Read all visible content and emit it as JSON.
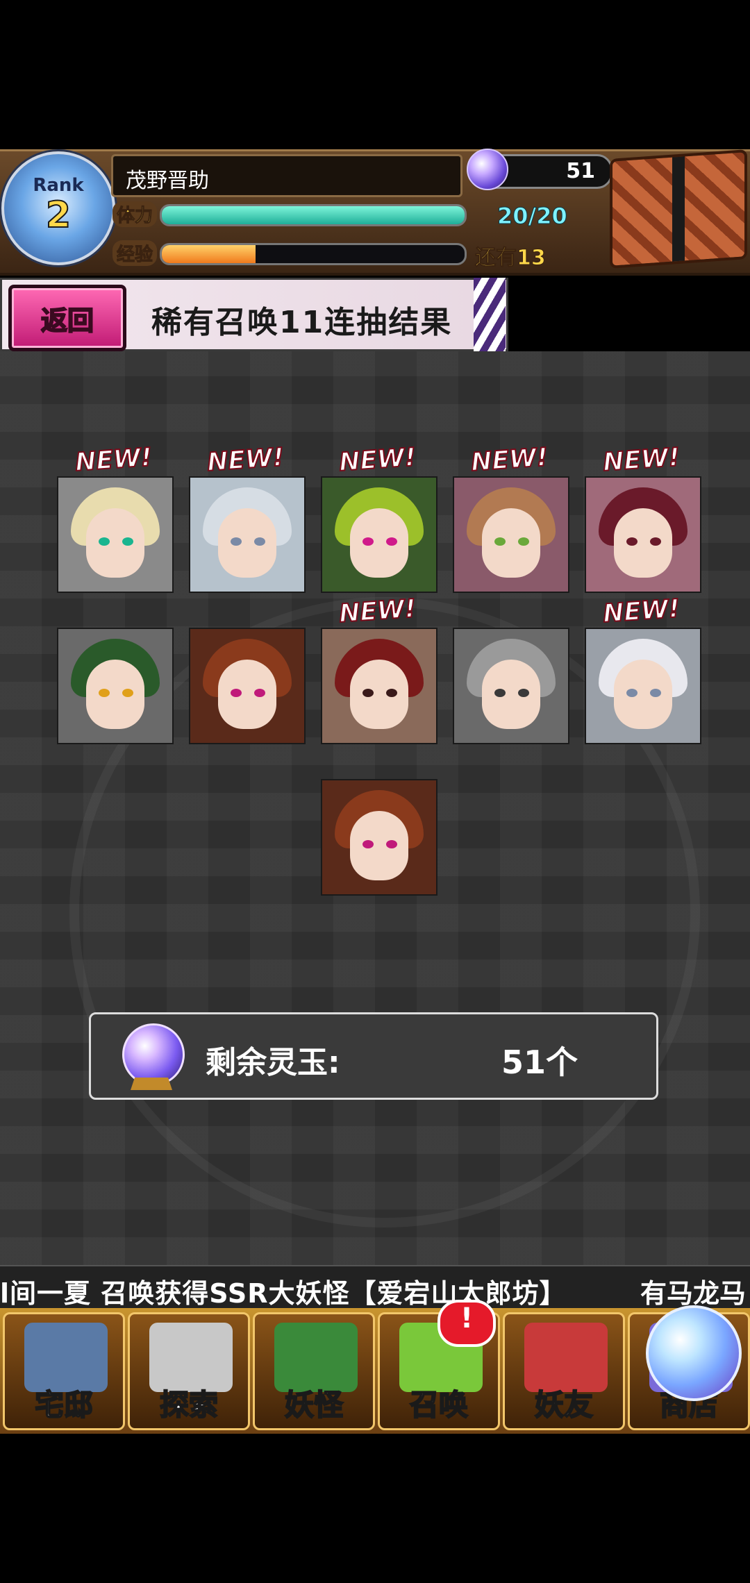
{
  "header": {
    "rank_label": "Rank",
    "rank_value": "2",
    "player_name": "茂野晋助",
    "orb_count": "51",
    "stamina_label": "体力",
    "stamina_value": "20/20",
    "stamina_fraction": 1.0,
    "exp_label": "经验",
    "exp_remaining": "还有13",
    "exp_fraction": 0.31
  },
  "banner": {
    "back_label": "返回",
    "title": "稀有召唤11连抽结果"
  },
  "results": [
    {
      "new": true,
      "badge": "NEW!",
      "hair": "#e8dcae",
      "eye": "#1ab58f",
      "bg": "#8a8a8a"
    },
    {
      "new": true,
      "badge": "NEW!",
      "hair": "#d6dde4",
      "eye": "#7a8aa6",
      "bg": "#b6c2cc"
    },
    {
      "new": true,
      "badge": "NEW!",
      "hair": "#9cc02a",
      "eye": "#d01a8a",
      "bg": "#3a5a2a"
    },
    {
      "new": true,
      "badge": "NEW!",
      "hair": "#b27a52",
      "eye": "#6aa83a",
      "bg": "#8a5a6a"
    },
    {
      "new": true,
      "badge": "NEW!",
      "hair": "#6a1a2a",
      "eye": "#6a1a2a",
      "bg": "#a06a7a"
    },
    {
      "new": false,
      "badge": "",
      "hair": "#2a5a2a",
      "eye": "#e0a01a",
      "bg": "#6a6a6a"
    },
    {
      "new": false,
      "badge": "",
      "hair": "#8a3a1c",
      "eye": "#c01a7a",
      "bg": "#5a2a1a"
    },
    {
      "new": true,
      "badge": "NEW!",
      "hair": "#7a1a1a",
      "eye": "#3a1a1a",
      "bg": "#8a6a5a"
    },
    {
      "new": false,
      "badge": "",
      "hair": "#9a9a9a",
      "eye": "#3a3a3a",
      "bg": "#6a6a6a"
    },
    {
      "new": true,
      "badge": "NEW!",
      "hair": "#e8e8ee",
      "eye": "#7a8aa6",
      "bg": "#9aa0a8"
    },
    {
      "new": false,
      "badge": "",
      "hair": "#8a3a1c",
      "eye": "#c01a7a",
      "bg": "#5a2a1a"
    }
  ],
  "orbs_panel": {
    "label": "剩余灵玉:",
    "value": "51个"
  },
  "ticker": {
    "text": "l间一夏 召唤获得SSR大妖怪【爱宕山太郎坊】",
    "text2": "有马龙马"
  },
  "nav": [
    {
      "label": "宅邸",
      "art": "#5a7aa6"
    },
    {
      "label": "探索",
      "art": "#c8c8c8"
    },
    {
      "label": "妖怪",
      "art": "#3a8a3a"
    },
    {
      "label": "召唤",
      "art": "#7ac83a"
    },
    {
      "label": "妖友",
      "art": "#c83a3a"
    },
    {
      "label": "商店",
      "art": "#7a6ad8"
    }
  ],
  "nav_alert": "!"
}
